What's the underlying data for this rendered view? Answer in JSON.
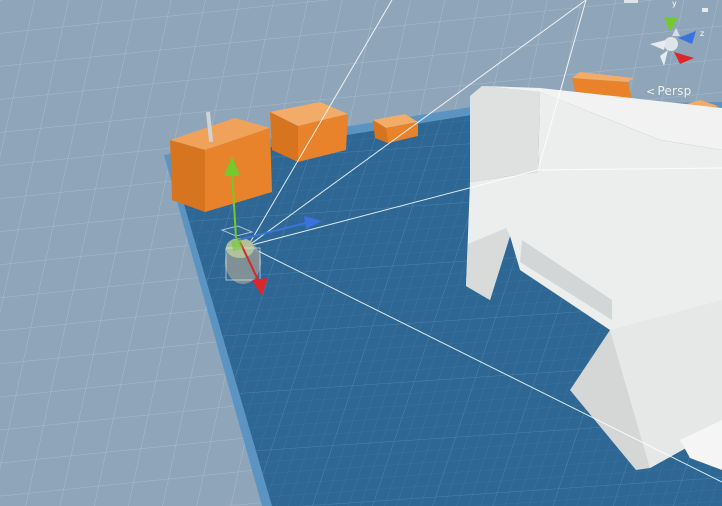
{
  "scene_view": {
    "projection_label": "Persp",
    "colors": {
      "sky_grid": "#8fa6ba",
      "floor": "#2e6794",
      "floor_edge": "#5b94c2",
      "box_orange": "#e8822b",
      "wall_white": "#eaeceb",
      "x_axis": "#d9272c",
      "y_axis": "#73c92e",
      "z_axis": "#3a72e0"
    },
    "gizmo": {
      "labels": {
        "y": "y",
        "z": "z"
      }
    },
    "icons": {
      "projection_toggle": "perspective-arrow-icon",
      "orientation": "orientation-gizmo-icon",
      "move_tool": "move-handle-icon"
    }
  }
}
